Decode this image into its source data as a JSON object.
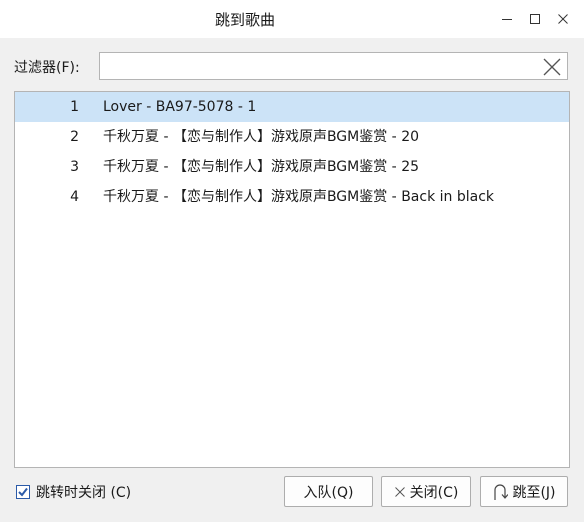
{
  "window": {
    "title": "跳到歌曲"
  },
  "filter": {
    "label": "过滤器(F):",
    "value": "",
    "placeholder": ""
  },
  "list": {
    "items": [
      {
        "index": "1",
        "text": "Lover - BA97-5078 - 1",
        "selected": true
      },
      {
        "index": "2",
        "text": "千秋万夏 - 【恋与制作人】游戏原声BGM鉴赏 - 20",
        "selected": false
      },
      {
        "index": "3",
        "text": "千秋万夏 - 【恋与制作人】游戏原声BGM鉴赏 - 25",
        "selected": false
      },
      {
        "index": "4",
        "text": "千秋万夏 - 【恋与制作人】游戏原声BGM鉴赏 - Back in black",
        "selected": false
      }
    ]
  },
  "options": {
    "close_after_jump_label": "跳转时关闭 (C)",
    "close_after_jump_checked": true
  },
  "buttons": {
    "enqueue": "入队(Q)",
    "close": "关闭(C)",
    "jump": "跳至(J)"
  },
  "icons": {
    "minimize": "minimize-icon",
    "maximize": "maximize-icon",
    "close": "close-icon",
    "clear": "clear-icon",
    "jump": "jump-arrow-icon"
  },
  "colors": {
    "selection": "#cce3f7",
    "checkbox_accent": "#2b5aa8"
  }
}
